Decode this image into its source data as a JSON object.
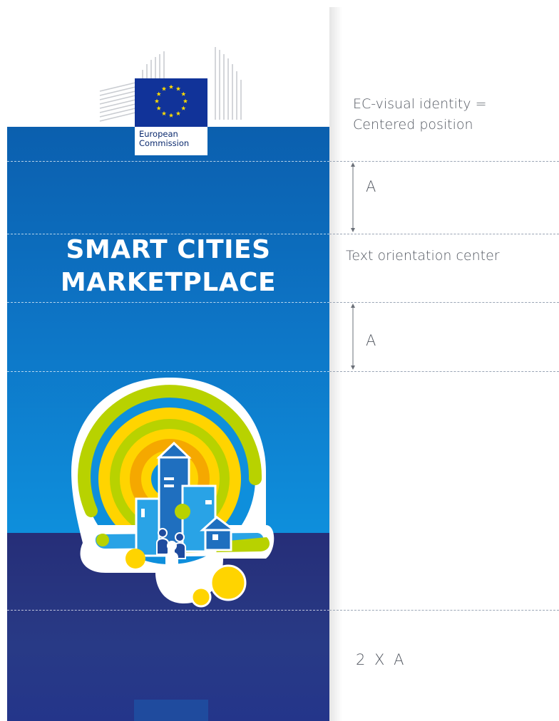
{
  "ec_logo": {
    "line1": "European",
    "line2": "Commission"
  },
  "title": {
    "line1": "SMART CITIES",
    "line2": "MARKETPLACE"
  },
  "annotations": {
    "ec_identity_line1": "EC-visual identity =",
    "ec_identity_line2": "Centered position",
    "spacing_a_top": "A",
    "text_orientation": "Text orientation center",
    "spacing_a_bottom": "A",
    "spacing_bottom": "2 X A"
  },
  "colors": {
    "banner_blue_top": "#0b5fae",
    "banner_blue_mid": "#0e8fdc",
    "banner_navy": "#262e78",
    "eu_flag_blue": "#113399",
    "eu_star_yellow": "#ffdd00",
    "ring_green": "#b8d200",
    "ring_yellow": "#ffd400",
    "ring_orange": "#f5a800",
    "annotation_text": "#555a63",
    "guide_line": "#9aa5b5"
  },
  "icons": {
    "building": "berlaymont-building-icon",
    "flag": "eu-flag-icon",
    "illustration": "smart-city-illustration"
  }
}
